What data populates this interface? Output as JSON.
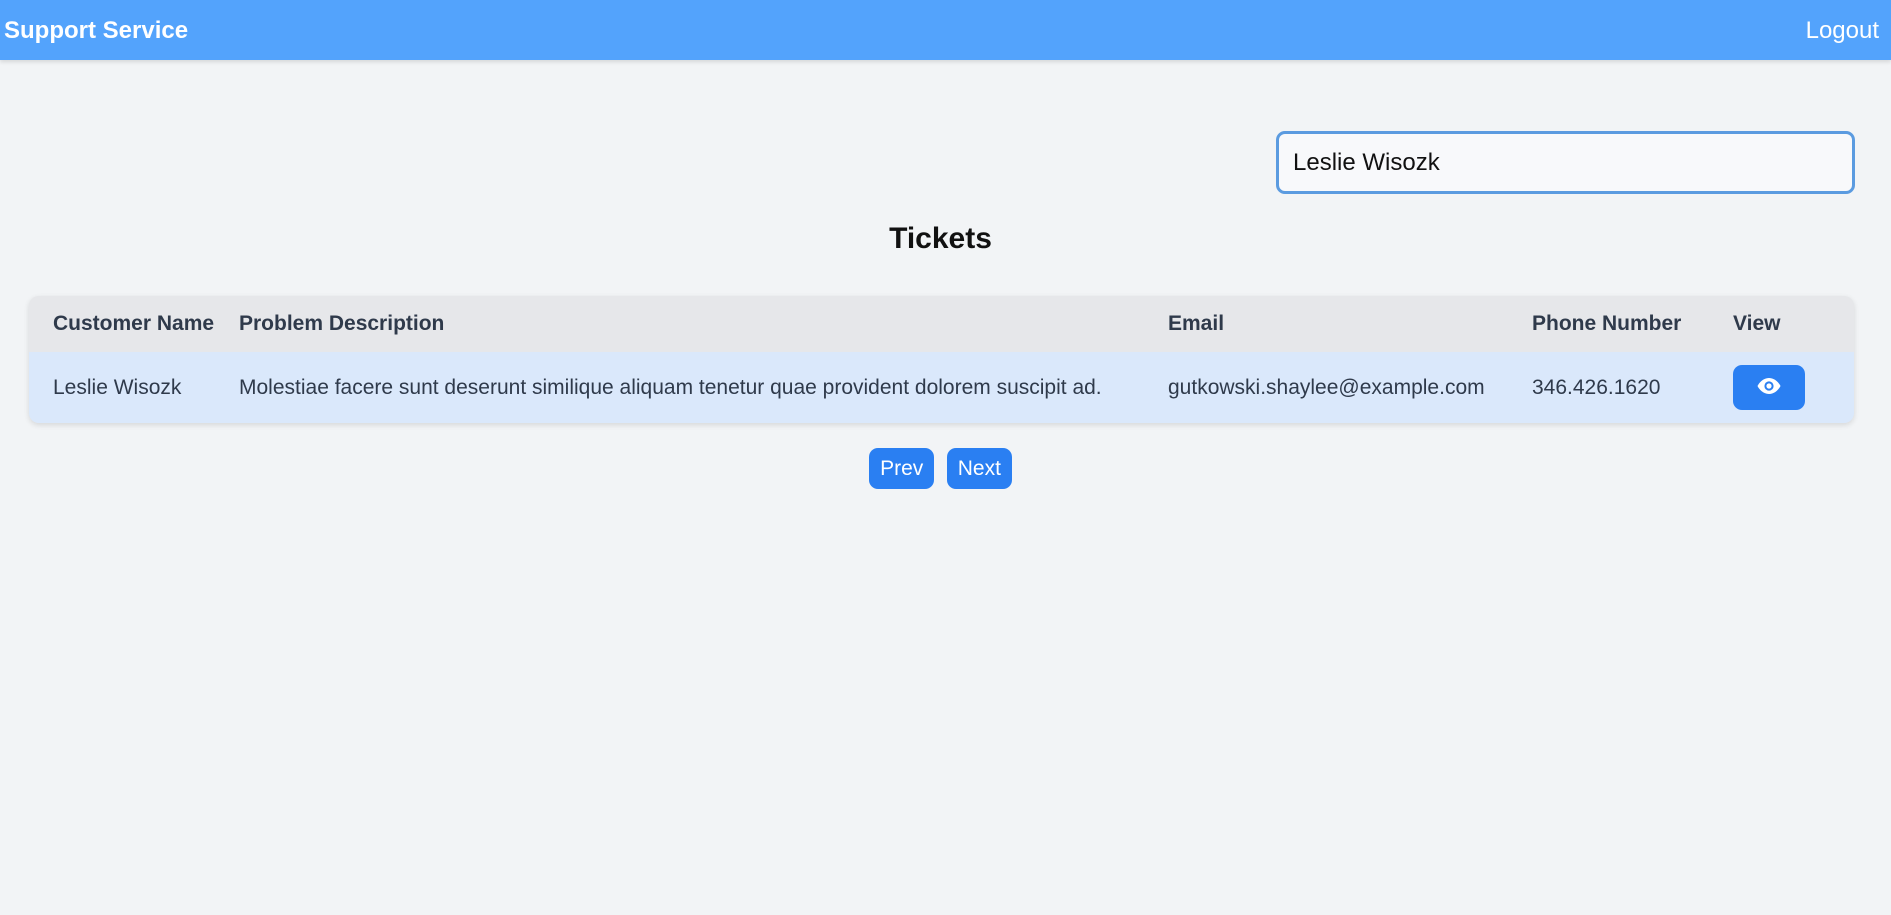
{
  "header": {
    "title": "Support Service",
    "logout_label": "Logout"
  },
  "search": {
    "value": "Leslie Wisozk"
  },
  "main": {
    "title": "Tickets"
  },
  "table": {
    "columns": [
      "Customer Name",
      "Problem Description",
      "Email",
      "Phone Number",
      "View"
    ],
    "rows": [
      {
        "customer_name": "Leslie Wisozk",
        "problem_description": "Molestiae facere sunt deserunt similique aliquam tenetur quae provident dolorem suscipit ad.",
        "email": "gutkowski.shaylee@example.com",
        "phone": "346.426.1620",
        "view_icon": "eye-icon"
      }
    ]
  },
  "pagination": {
    "prev_label": "Prev",
    "next_label": "Next"
  },
  "colors": {
    "header_bg": "#53a3fc",
    "accent": "#2a7ff2",
    "row_highlight": "#dae8fb"
  }
}
